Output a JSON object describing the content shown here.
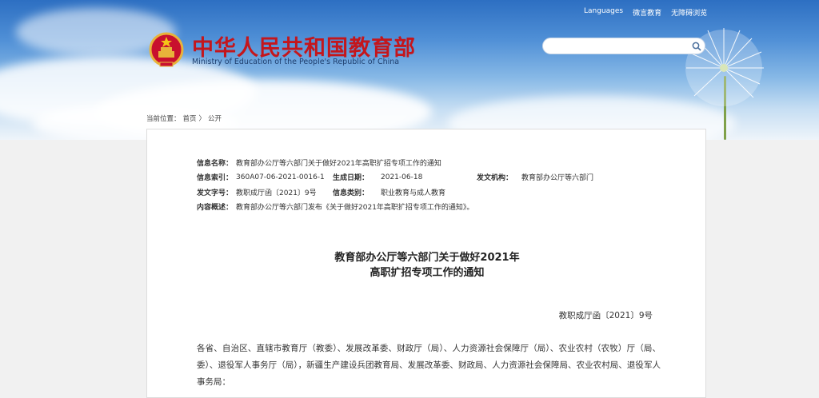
{
  "header": {
    "top_links": [
      "Languages",
      "微言教育",
      "无障碍浏览"
    ],
    "title_cn": "中华人民共和国教育部",
    "title_en": "Ministry of Education of the People's Republic of China",
    "search_placeholder": ""
  },
  "breadcrumb": {
    "prefix": "当前位置：",
    "home": "首页",
    "sep": "〉",
    "current": "公开"
  },
  "meta": {
    "name_label": "信息名称：",
    "name_value": "教育部办公厅等六部门关于做好2021年高职扩招专项工作的通知",
    "index_label": "信息索引：",
    "index_value": "360A07-06-2021-0016-1",
    "date_label": "生成日期：",
    "date_value": "2021-06-18",
    "org_label": "发文机构：",
    "org_value": "教育部办公厅等六部门",
    "docno_label": "发文字号：",
    "docno_value": "教职成厅函〔2021〕9号",
    "category_label": "信息类别：",
    "category_value": "职业教育与成人教育",
    "summary_label": "内容概述：",
    "summary_value": "教育部办公厅等六部门发布《关于做好2021年高职扩招专项工作的通知》。"
  },
  "document": {
    "title_line1": "教育部办公厅等六部门关于做好2021年",
    "title_line2": "高职扩招专项工作的通知",
    "doc_number": "教职成厅函〔2021〕9号",
    "body": "各省、自治区、直辖市教育厅（教委）、发展改革委、财政厅（局）、人力资源社会保障厅（局）、农业农村（农牧）厅（局、委）、退役军人事务厅（局），新疆生产建设兵团教育局、发展改革委、财政局、人力资源社会保障局、农业农村局、退役军人事务局："
  },
  "colors": {
    "title_red": "#c4161c",
    "sky_blue": "#4f8fd6"
  }
}
